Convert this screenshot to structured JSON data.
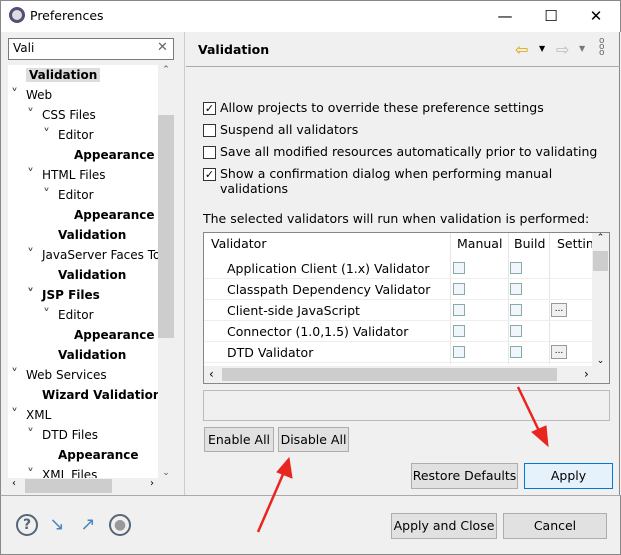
{
  "window": {
    "title": "Preferences",
    "icon": "gear-icon",
    "controls": [
      "minimize-icon",
      "maximize-icon",
      "close-icon"
    ]
  },
  "filter": {
    "value": "Vali"
  },
  "tree": [
    {
      "label": "Validation",
      "level": 0,
      "bold": true,
      "selected": true,
      "chevron": false
    },
    {
      "label": "Web",
      "level": 0,
      "bold": false,
      "chevron": true
    },
    {
      "label": "CSS Files",
      "level": 1,
      "bold": false,
      "chevron": true
    },
    {
      "label": "Editor",
      "level": 2,
      "bold": false,
      "chevron": true
    },
    {
      "label": "Appearance",
      "level": 3,
      "bold": true,
      "chevron": false
    },
    {
      "label": "HTML Files",
      "level": 1,
      "bold": false,
      "chevron": true
    },
    {
      "label": "Editor",
      "level": 2,
      "bold": false,
      "chevron": true
    },
    {
      "label": "Appearance",
      "level": 3,
      "bold": true,
      "chevron": false
    },
    {
      "label": "Validation",
      "level": 2,
      "bold": true,
      "chevron": false
    },
    {
      "label": "JavaServer Faces To",
      "level": 1,
      "bold": false,
      "chevron": true
    },
    {
      "label": "Validation",
      "level": 2,
      "bold": true,
      "chevron": false
    },
    {
      "label": "JSP Files",
      "level": 1,
      "bold": true,
      "chevron": true
    },
    {
      "label": "Editor",
      "level": 2,
      "bold": false,
      "chevron": true
    },
    {
      "label": "Appearance",
      "level": 3,
      "bold": true,
      "chevron": false
    },
    {
      "label": "Validation",
      "level": 2,
      "bold": true,
      "chevron": false
    },
    {
      "label": "Web Services",
      "level": 0,
      "bold": false,
      "chevron": true
    },
    {
      "label": "Wizard Validation",
      "level": 1,
      "bold": true,
      "chevron": false
    },
    {
      "label": "XML",
      "level": 0,
      "bold": false,
      "chevron": true
    },
    {
      "label": "DTD Files",
      "level": 1,
      "bold": false,
      "chevron": true
    },
    {
      "label": "Appearance",
      "level": 2,
      "bold": true,
      "chevron": false
    },
    {
      "label": "XML Files",
      "level": 1,
      "bold": false,
      "chevron": true
    }
  ],
  "page": {
    "title": "Validation",
    "options": [
      {
        "label": "Allow projects to override these preference settings",
        "checked": true
      },
      {
        "label": "Suspend all validators",
        "checked": false
      },
      {
        "label": "Save all modified resources automatically prior to validating",
        "checked": false
      },
      {
        "label": "Show a confirmation dialog when performing manual validations",
        "checked": true
      }
    ],
    "table_caption": "The selected validators will run when validation is performed:",
    "columns": [
      "Validator",
      "Manual",
      "Build",
      "Settings"
    ],
    "rows": [
      {
        "name": "Application Client (1.x) Validator",
        "manual": false,
        "build": false,
        "settings": false
      },
      {
        "name": "Classpath Dependency Validator",
        "manual": false,
        "build": false,
        "settings": false
      },
      {
        "name": "Client-side JavaScript",
        "manual": false,
        "build": false,
        "settings": true
      },
      {
        "name": "Connector (1.0,1.5) Validator",
        "manual": false,
        "build": false,
        "settings": false
      },
      {
        "name": "DTD Validator",
        "manual": false,
        "build": false,
        "settings": true
      }
    ],
    "settings_button": "...",
    "enable_all": "Enable All",
    "disable_all": "Disable All",
    "restore_defaults": "Restore Defaults",
    "apply": "Apply"
  },
  "footer": {
    "apply_close": "Apply and Close",
    "cancel": "Cancel",
    "icons": [
      "help-icon",
      "import-icon",
      "export-icon",
      "record-icon"
    ]
  },
  "annotation_color": "#e8251f"
}
